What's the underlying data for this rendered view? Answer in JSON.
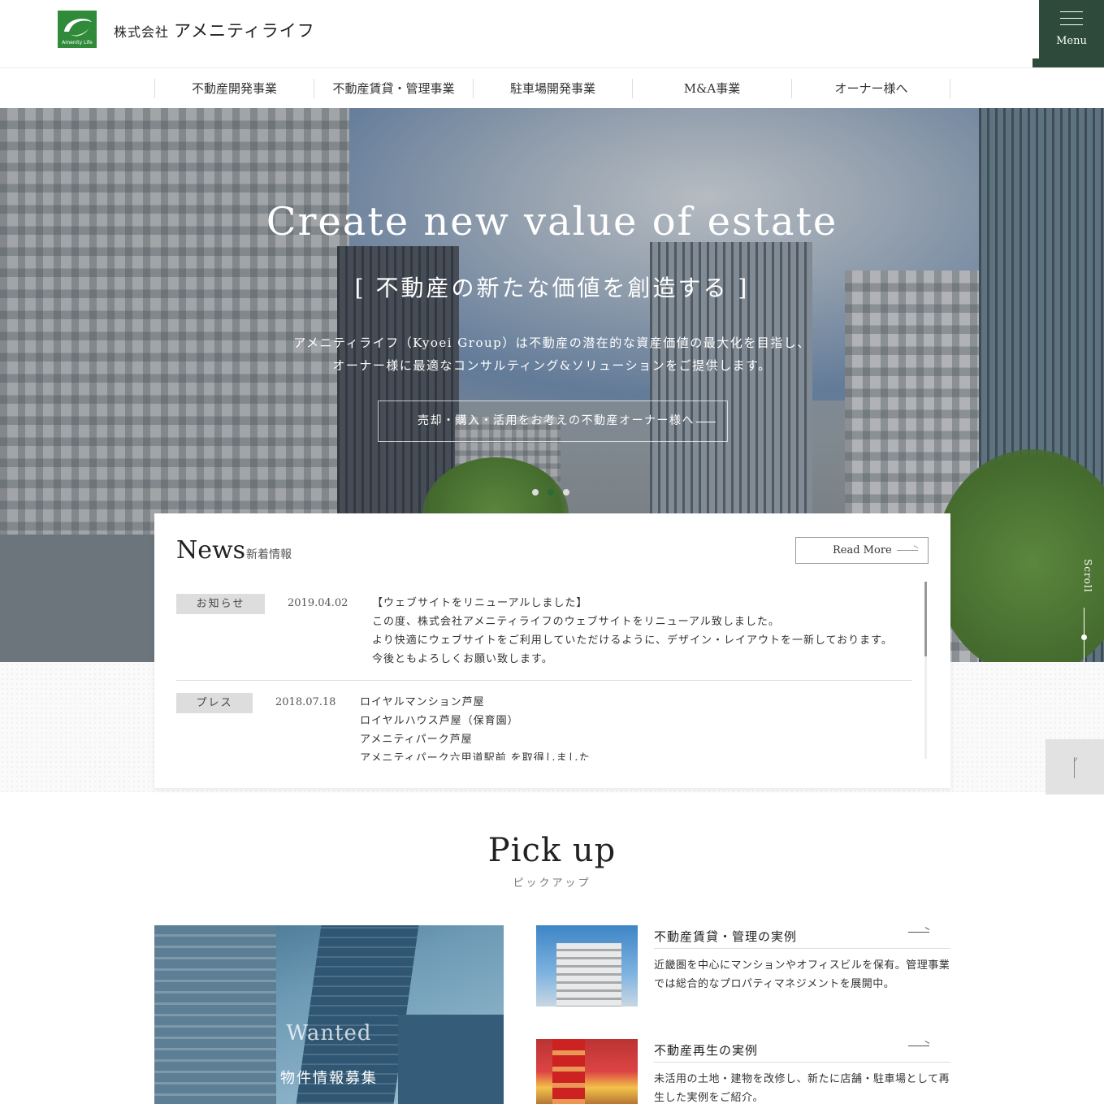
{
  "header": {
    "logo_text": "Amenity Life",
    "company_prefix": "株式会社",
    "company_name": "アメニティライフ",
    "menu_label": "Menu"
  },
  "nav": {
    "items": [
      {
        "label": "不動産開発事業"
      },
      {
        "label": "不動産賃貸・管理事業"
      },
      {
        "label": "駐車場開発事業"
      },
      {
        "label": "M&A事業"
      },
      {
        "label": "オーナー様へ"
      }
    ]
  },
  "hero": {
    "title": "Create new value of estate",
    "subtitle": "[ 不動産の新たな価値を創造する ]",
    "desc_line1": "アメニティライフ（Kyoei Group）は不動産の潜在的な資産価値の最大化を目指し、",
    "desc_line2": "オーナー様に最適なコンサルティング&ソリューションをご提供します。",
    "cta": "売却・購入・活用をお考えの不動産オーナー様へ",
    "slides": 3,
    "active_slide": 2,
    "scroll_label": "Scroll"
  },
  "news": {
    "title": "News",
    "title_ja": "新着情報",
    "read_more": "Read More",
    "items": [
      {
        "category": "お知らせ",
        "date": "2019.04.02",
        "lines": [
          "【ウェブサイトをリニューアルしました】",
          "この度、株式会社アメニティライフのウェブサイトをリニューアル致しました。",
          "より快適にウェブサイトをご利用していただけるように、デザイン・レイアウトを一新しております。",
          "今後ともよろしくお願い致します。"
        ]
      },
      {
        "category": "プレス",
        "date": "2018.07.18",
        "lines": [
          "ロイヤルマンション芦屋",
          "ロイヤルハウス芦屋（保育園）",
          "アメニティパーク芦屋",
          "アメニティパーク六甲道駅前 を取得しました"
        ]
      }
    ]
  },
  "pickup": {
    "title": "Pick up",
    "title_ja": "ピックアップ",
    "wanted_en": "Wanted",
    "wanted_ja": "物件情報募集",
    "cards": [
      {
        "title": "不動産賃貸・管理の実例",
        "desc": "近畿圏を中心にマンションやオフィスビルを保有。管理事業では総合的なプロパティマネジメントを展開中。"
      },
      {
        "title": "不動産再生の実例",
        "desc": "未活用の土地・建物を改修し、新たに店舗・駐車場として再生した実例をご紹介。"
      }
    ]
  },
  "colors": {
    "brand_green": "#2d4a3a",
    "logo_green": "#2f8a3a",
    "active_dot": "#2d6a3a"
  }
}
